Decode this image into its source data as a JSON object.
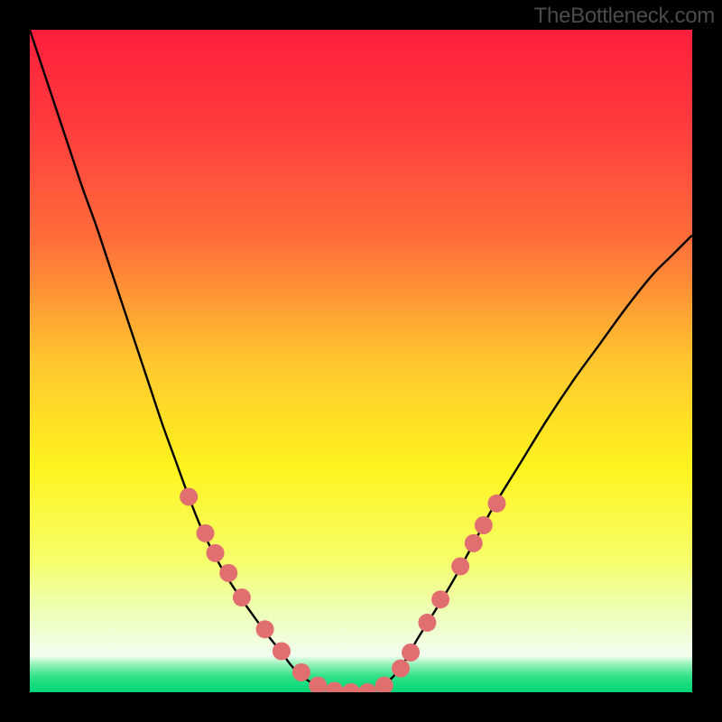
{
  "watermark": "TheBottleneck.com",
  "colors": {
    "frame": "#000000",
    "curve": "#000000",
    "curve_width": 2.4,
    "marker_fill": "#e26f6f",
    "marker_radius": 10,
    "bottom_band": "#00e676",
    "gradient_stops": [
      {
        "offset": 0.0,
        "color": "#ff1f3b"
      },
      {
        "offset": 0.14,
        "color": "#ff3a3e"
      },
      {
        "offset": 0.32,
        "color": "#ff6f3a"
      },
      {
        "offset": 0.5,
        "color": "#ffc62f"
      },
      {
        "offset": 0.66,
        "color": "#fff31e"
      },
      {
        "offset": 0.8,
        "color": "#f6ff6a"
      },
      {
        "offset": 0.88,
        "color": "#edffb8"
      },
      {
        "offset": 0.945,
        "color": "#f3fff0"
      },
      {
        "offset": 0.955,
        "color": "#a8f5c3"
      },
      {
        "offset": 0.975,
        "color": "#34e28a"
      },
      {
        "offset": 1.0,
        "color": "#00d675"
      }
    ]
  },
  "chart_data": {
    "type": "line",
    "x": [
      0.0,
      0.02,
      0.04,
      0.06,
      0.08,
      0.1,
      0.12,
      0.14,
      0.16,
      0.18,
      0.2,
      0.22,
      0.24,
      0.26,
      0.28,
      0.3,
      0.32,
      0.34,
      0.36,
      0.38,
      0.395,
      0.41,
      0.43,
      0.455,
      0.48,
      0.5,
      0.52,
      0.545,
      0.565,
      0.585,
      0.61,
      0.64,
      0.67,
      0.7,
      0.74,
      0.78,
      0.82,
      0.86,
      0.9,
      0.94,
      0.97,
      1.0
    ],
    "y": [
      1.0,
      0.94,
      0.88,
      0.82,
      0.76,
      0.705,
      0.645,
      0.585,
      0.525,
      0.465,
      0.405,
      0.35,
      0.295,
      0.245,
      0.205,
      0.17,
      0.14,
      0.112,
      0.085,
      0.06,
      0.04,
      0.025,
      0.012,
      0.004,
      0.0,
      0.0,
      0.005,
      0.02,
      0.045,
      0.08,
      0.12,
      0.17,
      0.225,
      0.28,
      0.345,
      0.41,
      0.47,
      0.525,
      0.58,
      0.63,
      0.66,
      0.69
    ],
    "xlim": [
      0,
      1
    ],
    "ylim": [
      0,
      1
    ],
    "title": "",
    "xlabel": "",
    "ylabel": "",
    "series": [
      {
        "name": "bottleneck-curve",
        "role": "line"
      },
      {
        "name": "markers-left",
        "role": "scatter",
        "points": [
          {
            "x": 0.24,
            "y": 0.295
          },
          {
            "x": 0.265,
            "y": 0.24
          },
          {
            "x": 0.28,
            "y": 0.21
          },
          {
            "x": 0.3,
            "y": 0.18
          },
          {
            "x": 0.32,
            "y": 0.143
          },
          {
            "x": 0.355,
            "y": 0.095
          },
          {
            "x": 0.38,
            "y": 0.062
          },
          {
            "x": 0.41,
            "y": 0.03
          }
        ]
      },
      {
        "name": "markers-bottom",
        "role": "scatter",
        "points": [
          {
            "x": 0.435,
            "y": 0.01
          },
          {
            "x": 0.46,
            "y": 0.002
          },
          {
            "x": 0.485,
            "y": 0.0
          },
          {
            "x": 0.51,
            "y": 0.0
          },
          {
            "x": 0.535,
            "y": 0.01
          }
        ]
      },
      {
        "name": "markers-right",
        "role": "scatter",
        "points": [
          {
            "x": 0.56,
            "y": 0.036
          },
          {
            "x": 0.575,
            "y": 0.06
          },
          {
            "x": 0.6,
            "y": 0.105
          },
          {
            "x": 0.62,
            "y": 0.14
          },
          {
            "x": 0.65,
            "y": 0.19
          },
          {
            "x": 0.67,
            "y": 0.225
          },
          {
            "x": 0.685,
            "y": 0.252
          },
          {
            "x": 0.705,
            "y": 0.285
          }
        ]
      }
    ]
  }
}
